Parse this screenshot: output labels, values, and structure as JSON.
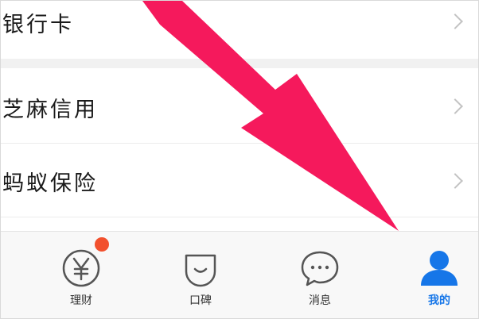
{
  "menu": {
    "items": [
      {
        "label": "银行卡"
      },
      {
        "label": "芝麻信用"
      },
      {
        "label": "蚂蚁保险"
      }
    ]
  },
  "tabbar": {
    "tabs": [
      {
        "label": "理财",
        "icon": "yen-circle-icon"
      },
      {
        "label": "口碑",
        "icon": "smile-bag-icon"
      },
      {
        "label": "消息",
        "icon": "chat-bubble-icon"
      },
      {
        "label": "我的",
        "icon": "user-icon",
        "active": true
      }
    ],
    "badge_color": "#f2502d",
    "active_color": "#1676e8"
  },
  "annotation": {
    "arrow_color": "#f5195c"
  }
}
